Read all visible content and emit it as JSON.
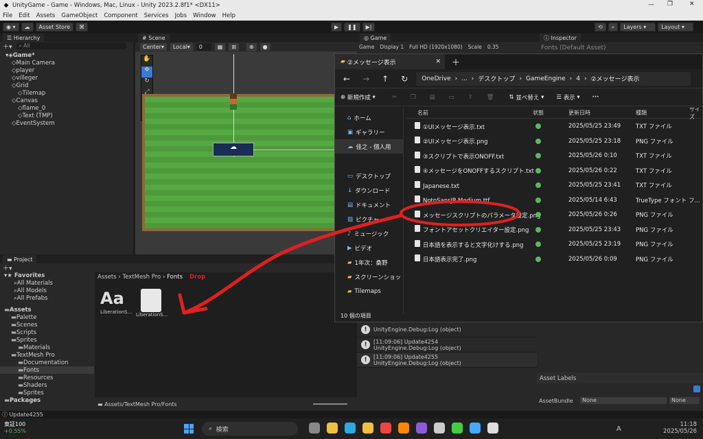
{
  "window_title": "UnityGame - Game - Windows, Mac, Linux - Unity 2023.2.8f1* <DX11>",
  "menu": [
    "File",
    "Edit",
    "Assets",
    "GameObject",
    "Component",
    "Services",
    "Jobs",
    "Window",
    "Help"
  ],
  "toolbar": {
    "asset_store": "Asset Store",
    "layers": "Layers",
    "layout": "Layout"
  },
  "hierarchy": {
    "tab": "Hierarchy",
    "search_placeholder": "All",
    "items": [
      {
        "label": "Game*",
        "depth": 0
      },
      {
        "label": "Main Camera",
        "depth": 1
      },
      {
        "label": "player",
        "depth": 1
      },
      {
        "label": "villeger",
        "depth": 1
      },
      {
        "label": "Grid",
        "depth": 1
      },
      {
        "label": "Tilemap",
        "depth": 2
      },
      {
        "label": "Canvas",
        "depth": 1
      },
      {
        "label": "flame_0",
        "depth": 2
      },
      {
        "label": "Text (TMP)",
        "depth": 2
      },
      {
        "label": "EventSystem",
        "depth": 1
      }
    ]
  },
  "scene": {
    "tab": "Scene",
    "pivot": "Center",
    "space": "Local",
    "snap": "0"
  },
  "game": {
    "tab": "Game",
    "display": "Game",
    "display_num": "Display 1",
    "resolution": "Full HD (1920x1080)",
    "scale_label": "Scale",
    "scale_value": "0.35"
  },
  "inspector": {
    "tab": "Inspector",
    "subtitle": "Fonts (Default Asset)",
    "asset_labels": "Asset Labels",
    "bundle_label": "AssetBundle",
    "bundle_value": "None",
    "variant_value": "None"
  },
  "project": {
    "tab": "Project",
    "breadcrumb": [
      "Assets",
      "TextMesh Pro",
      "Fonts"
    ],
    "drop_label": "Drop",
    "favorites": {
      "label": "Favorites",
      "items": [
        "All Materials",
        "All Models",
        "All Prefabs"
      ]
    },
    "tree": [
      {
        "label": "Assets",
        "depth": 0
      },
      {
        "label": "Palette",
        "depth": 1
      },
      {
        "label": "Scenes",
        "depth": 1
      },
      {
        "label": "Scripts",
        "depth": 1
      },
      {
        "label": "Sprites",
        "depth": 1
      },
      {
        "label": "Materials",
        "depth": 2
      },
      {
        "label": "TextMesh Pro",
        "depth": 1
      },
      {
        "label": "Documentation",
        "depth": 2
      },
      {
        "label": "Fonts",
        "depth": 2
      },
      {
        "label": "Resources",
        "depth": 2
      },
      {
        "label": "Shaders",
        "depth": 2
      },
      {
        "label": "Sprites",
        "depth": 2
      },
      {
        "label": "Packages",
        "depth": 0
      }
    ],
    "assets": [
      {
        "label": "LiberationS...",
        "icon": "font-icon"
      },
      {
        "label": "LiberationS...",
        "icon": "document-icon"
      }
    ],
    "footer_path": "Assets/TextMesh Pro/Fonts"
  },
  "console": {
    "rows": [
      {
        "line1": "",
        "line2": "UnityEngine.Debug:Log (object)"
      },
      {
        "line1": "[11:09:06] Update4254",
        "line2": "UnityEngine.Debug:Log (object)"
      },
      {
        "line1": "[11:09:06] Update4255",
        "line2": "UnityEngine.Debug:Log (object)"
      }
    ]
  },
  "status_text": "Update4255",
  "explorer": {
    "tab_title": "②メッセージ表示",
    "path": [
      "OneDrive",
      "...",
      "デスクトップ",
      "GameEngine",
      "4",
      "②メッセージ表示"
    ],
    "new_label": "新規作成",
    "sort_label": "並べ替え",
    "view_label": "表示",
    "columns": {
      "name": "名前",
      "status": "状態",
      "date": "更新日時",
      "type": "種類",
      "size": "サイズ"
    },
    "nav": [
      {
        "label": "ホーム",
        "icon": "home-icon"
      },
      {
        "label": "ギャラリー",
        "icon": "gallery-icon"
      },
      {
        "label": "佳之 - 個人用",
        "icon": "cloud-icon"
      },
      {
        "label": "デスクトップ",
        "icon": "desktop-icon"
      },
      {
        "label": "ダウンロード",
        "icon": "download-icon"
      },
      {
        "label": "ドキュメント",
        "icon": "document-icon"
      },
      {
        "label": "ピクチャ",
        "icon": "picture-icon"
      },
      {
        "label": "ミュージック",
        "icon": "music-icon"
      },
      {
        "label": "ビデオ",
        "icon": "video-icon"
      },
      {
        "label": "1年次：桑野",
        "icon": "folder-icon"
      },
      {
        "label": "スクリーンショッ",
        "icon": "folder-icon"
      },
      {
        "label": "Tilemaps",
        "icon": "folder-icon"
      }
    ],
    "files": [
      {
        "name": "①UIメッセージ表示.txt",
        "date": "2025/05/25 23:49",
        "type": "TXT ファイル"
      },
      {
        "name": "②UIメッセージ表示.png",
        "date": "2025/05/25 23:18",
        "type": "PNG ファイル"
      },
      {
        "name": "③スクリプトで表示ONOFF.txt",
        "date": "2025/05/26 0:10",
        "type": "TXT ファイル"
      },
      {
        "name": "④メッセージをONOFFするスクリプト.txt",
        "date": "2025/05/26 0:22",
        "type": "TXT ファイル"
      },
      {
        "name": "Japanese.txt",
        "date": "2025/05/25 23:41",
        "type": "TXT ファイル"
      },
      {
        "name": "NotoSansJP-Medium.ttf",
        "date": "2025/05/14 6:43",
        "type": "TrueType フォント フ..."
      },
      {
        "name": "メッセージスクリプトのパラメータ設定.png",
        "date": "2025/05/26 0:26",
        "type": "PNG ファイル"
      },
      {
        "name": "フォントアセットクリエイター設定.png",
        "date": "2025/05/25 23:43",
        "type": "PNG ファイル"
      },
      {
        "name": "日本語を表示すると文字化けする.png",
        "date": "2025/05/25 23:19",
        "type": "PNG ファイル"
      },
      {
        "name": "日本語表示完了.png",
        "date": "2025/05/26 0:09",
        "type": "PNG ファイル"
      }
    ],
    "item_count": "10 個の項目"
  },
  "taskbar": {
    "stock_name": "東証100",
    "stock_change": "+0.55%",
    "search_placeholder": "検索",
    "time": "11:18",
    "date": "2025/05/26",
    "ime": "A"
  },
  "colors": {
    "annotation": "#e02020",
    "accent": "#3a79d8",
    "status_ok": "#5cb85c"
  }
}
